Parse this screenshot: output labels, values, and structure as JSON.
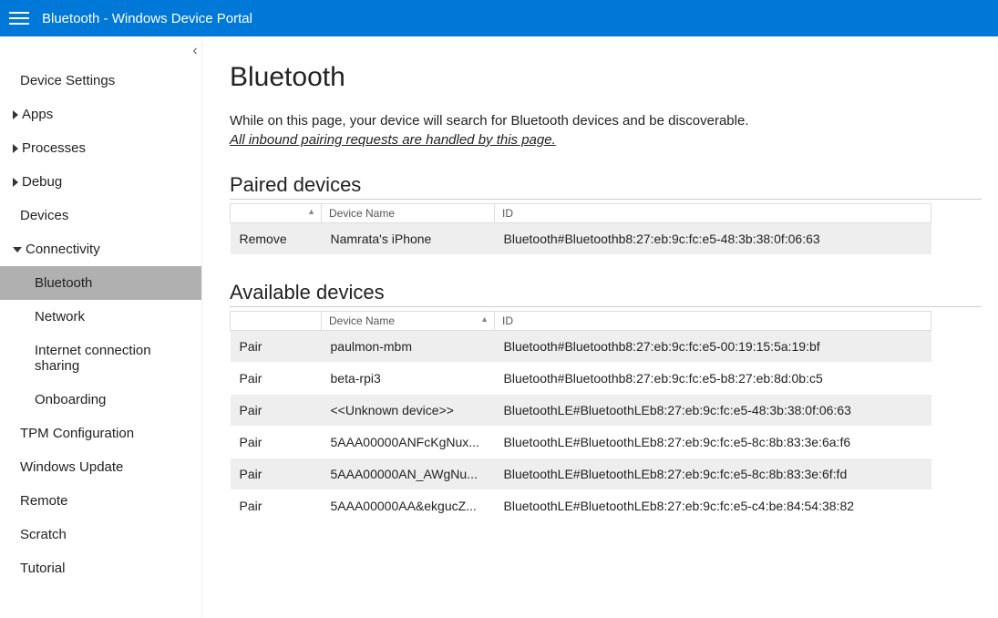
{
  "header": {
    "title": "Bluetooth - Windows Device Portal"
  },
  "sidebar": {
    "items": [
      {
        "label": "Device Settings",
        "caret": "none"
      },
      {
        "label": "Apps",
        "caret": "right"
      },
      {
        "label": "Processes",
        "caret": "right"
      },
      {
        "label": "Debug",
        "caret": "right"
      },
      {
        "label": "Devices",
        "caret": "none"
      },
      {
        "label": "Connectivity",
        "caret": "down",
        "children": [
          {
            "label": "Bluetooth",
            "selected": true
          },
          {
            "label": "Network"
          },
          {
            "label": "Internet connection sharing"
          },
          {
            "label": "Onboarding"
          }
        ]
      },
      {
        "label": "TPM Configuration",
        "caret": "none"
      },
      {
        "label": "Windows Update",
        "caret": "none"
      },
      {
        "label": "Remote",
        "caret": "none"
      },
      {
        "label": "Scratch",
        "caret": "none"
      },
      {
        "label": "Tutorial",
        "caret": "none"
      }
    ]
  },
  "page": {
    "title": "Bluetooth",
    "desc_line1": "While on this page, your device will search for Bluetooth devices and be discoverable.",
    "desc_line2": "All inbound pairing requests are handled by this page."
  },
  "paired": {
    "heading": "Paired devices",
    "columns": {
      "action": "",
      "name": "Device Name",
      "id": "ID"
    },
    "action_label": "Remove",
    "rows": [
      {
        "name": "Namrata's iPhone",
        "id": "Bluetooth#Bluetoothb8:27:eb:9c:fc:e5-48:3b:38:0f:06:63"
      }
    ]
  },
  "available": {
    "heading": "Available devices",
    "columns": {
      "action": "",
      "name": "Device Name",
      "id": "ID"
    },
    "action_label": "Pair",
    "rows": [
      {
        "name": "paulmon-mbm",
        "id": "Bluetooth#Bluetoothb8:27:eb:9c:fc:e5-00:19:15:5a:19:bf"
      },
      {
        "name": "beta-rpi3",
        "id": "Bluetooth#Bluetoothb8:27:eb:9c:fc:e5-b8:27:eb:8d:0b:c5"
      },
      {
        "name": "<<Unknown device>>",
        "id": "BluetoothLE#BluetoothLEb8:27:eb:9c:fc:e5-48:3b:38:0f:06:63"
      },
      {
        "name": "5AAA00000ANFcKgNux...",
        "id": "BluetoothLE#BluetoothLEb8:27:eb:9c:fc:e5-8c:8b:83:3e:6a:f6"
      },
      {
        "name": "5AAA00000AN_AWgNu...",
        "id": "BluetoothLE#BluetoothLEb8:27:eb:9c:fc:e5-8c:8b:83:3e:6f:fd"
      },
      {
        "name": "5AAA00000AA&ekgucZ...",
        "id": "BluetoothLE#BluetoothLEb8:27:eb:9c:fc:e5-c4:be:84:54:38:82"
      }
    ]
  }
}
